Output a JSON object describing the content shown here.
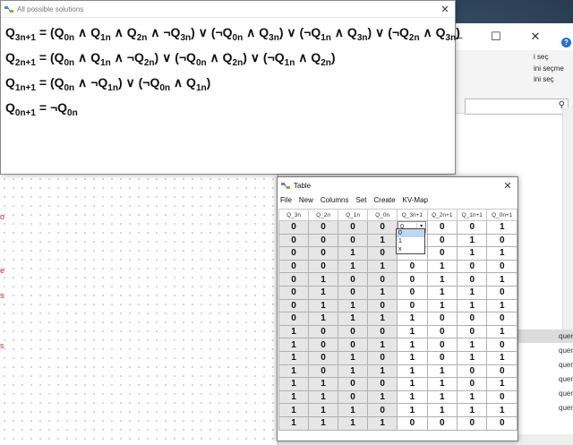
{
  "solutions_window": {
    "title": "All possible solutions",
    "close": "✕",
    "equations": [
      {
        "lhs": "Q",
        "lhs_sub": "3n+1",
        "rhs": [
          [
            "(Q",
            "0n"
          ],
          [
            " ∧ Q",
            "1n"
          ],
          [
            " ∧ Q",
            "2n"
          ],
          [
            " ∧ ¬Q",
            "3n"
          ],
          [
            ") ∨ (¬Q",
            "0n"
          ],
          [
            " ∧ Q",
            "3n"
          ],
          [
            ") ∨ (¬Q",
            "1n"
          ],
          [
            " ∧ Q",
            "3n"
          ],
          [
            ") ∨ (¬Q",
            "2n"
          ],
          [
            " ∧ Q",
            "3n"
          ],
          [
            ")",
            ""
          ]
        ]
      },
      {
        "lhs": "Q",
        "lhs_sub": "2n+1",
        "rhs": [
          [
            "(Q",
            "0n"
          ],
          [
            " ∧ Q",
            "1n"
          ],
          [
            " ∧ ¬Q",
            "2n"
          ],
          [
            ") ∨ (¬Q",
            "0n"
          ],
          [
            " ∧ Q",
            "2n"
          ],
          [
            ") ∨ (¬Q",
            "1n"
          ],
          [
            " ∧ Q",
            "2n"
          ],
          [
            ")",
            ""
          ]
        ]
      },
      {
        "lhs": "Q",
        "lhs_sub": "1n+1",
        "rhs": [
          [
            "(Q",
            "0n"
          ],
          [
            " ∧ ¬Q",
            "1n"
          ],
          [
            ") ∨ (¬Q",
            "0n"
          ],
          [
            " ∧ Q",
            "1n"
          ],
          [
            ")",
            ""
          ]
        ]
      },
      {
        "lhs": "Q",
        "lhs_sub": "0n+1",
        "rhs": [
          [
            "¬Q",
            "0n"
          ]
        ]
      }
    ]
  },
  "table_window": {
    "title": "Table",
    "close": "✕",
    "menu": [
      "File",
      "New",
      "Columns",
      "Set",
      "Create",
      "KV-Map"
    ],
    "columns": [
      "Q_3n",
      "Q_2n",
      "Q_1n",
      "Q_0n",
      "Q_3n+1",
      "Q_2n+1",
      "Q_1n+1",
      "Q_0n+1"
    ],
    "rows": [
      [
        "0",
        "0",
        "0",
        "0",
        "0",
        "0",
        "0",
        "1"
      ],
      [
        "0",
        "0",
        "0",
        "1",
        "",
        "0",
        "1",
        "0"
      ],
      [
        "0",
        "0",
        "1",
        "0",
        "",
        "0",
        "1",
        "1"
      ],
      [
        "0",
        "0",
        "1",
        "1",
        "0",
        "1",
        "0",
        "0"
      ],
      [
        "0",
        "1",
        "0",
        "0",
        "0",
        "1",
        "0",
        "1"
      ],
      [
        "0",
        "1",
        "0",
        "1",
        "0",
        "1",
        "1",
        "0"
      ],
      [
        "0",
        "1",
        "1",
        "0",
        "0",
        "1",
        "1",
        "1"
      ],
      [
        "0",
        "1",
        "1",
        "1",
        "1",
        "0",
        "0",
        "0"
      ],
      [
        "1",
        "0",
        "0",
        "0",
        "1",
        "0",
        "0",
        "1"
      ],
      [
        "1",
        "0",
        "0",
        "1",
        "1",
        "0",
        "1",
        "0"
      ],
      [
        "1",
        "0",
        "1",
        "0",
        "1",
        "0",
        "1",
        "1"
      ],
      [
        "1",
        "0",
        "1",
        "1",
        "1",
        "1",
        "0",
        "0"
      ],
      [
        "1",
        "1",
        "0",
        "0",
        "1",
        "1",
        "0",
        "1"
      ],
      [
        "1",
        "1",
        "0",
        "1",
        "1",
        "1",
        "1",
        "0"
      ],
      [
        "1",
        "1",
        "1",
        "0",
        "1",
        "1",
        "1",
        "1"
      ],
      [
        "1",
        "1",
        "1",
        "1",
        "0",
        "0",
        "0",
        "0"
      ]
    ],
    "dropdown": {
      "selected": "0",
      "arrow": "▾",
      "options": [
        "0",
        "1",
        "x"
      ]
    }
  },
  "background_window": {
    "ribbon_texts": [
      "i seç",
      "ini seçme",
      "ini seç"
    ],
    "help": "?",
    "search_icon": "⚲",
    "list_items": [
      "quential",
      "quential",
      "quential",
      "quential",
      "quential",
      "quential"
    ],
    "titlebar_buttons": [
      "—",
      "☐",
      "✕"
    ]
  },
  "canvas": {
    "edge_marks": [
      "o",
      "e",
      "s",
      "s"
    ]
  }
}
